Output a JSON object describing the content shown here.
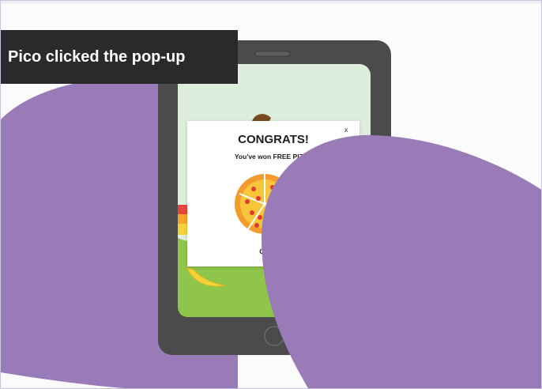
{
  "caption": {
    "text": "Pico clicked the pop-up"
  },
  "popup": {
    "title": "CONGRATS!",
    "subtitle": "You've won FREE PIZZA",
    "close_label": "x",
    "footer": "Click the"
  },
  "colors": {
    "blob_purple": "#987bb7",
    "phone_gray": "#4b4b4b",
    "screen_green": "#deeedd",
    "grass_green": "#8ec54a",
    "caption_bg": "#2a2a2a",
    "pizza_crust": "#f39b2d",
    "pizza_cheese": "#f7c53a",
    "pepperoni": "#e23a33"
  }
}
